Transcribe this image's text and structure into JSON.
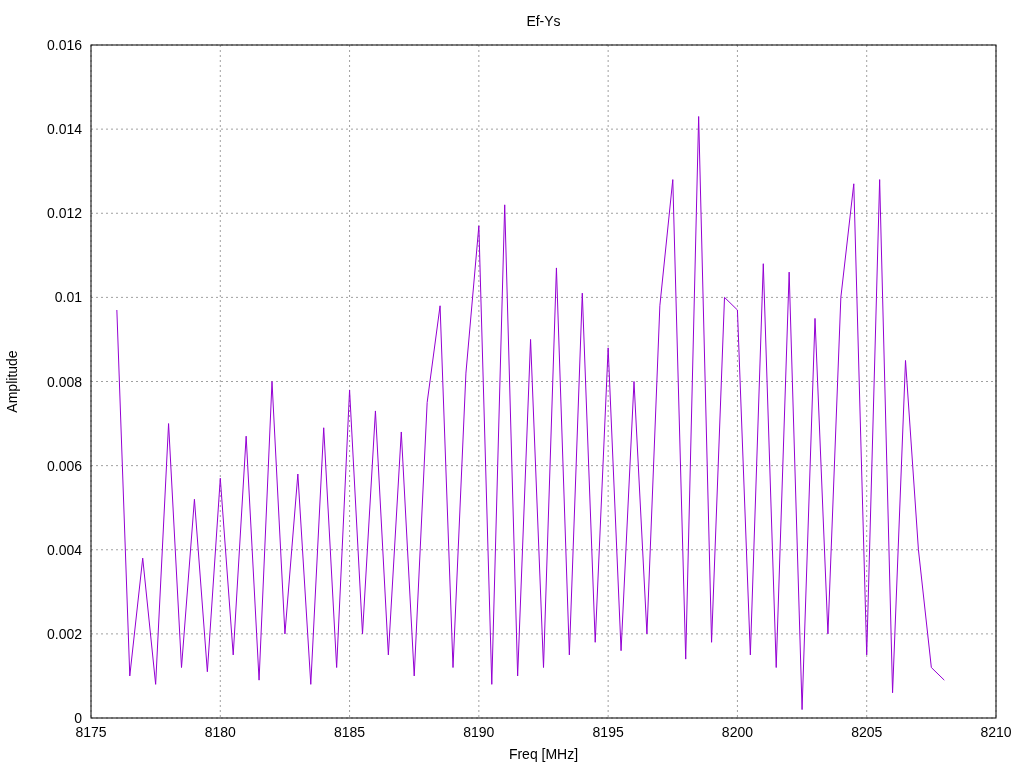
{
  "chart_data": {
    "type": "line",
    "title": "Ef-Ys",
    "xlabel": "Freq [MHz]",
    "ylabel": "Amplitude",
    "x": [
      8176,
      8176.5,
      8177,
      8177.5,
      8178,
      8178.5,
      8179,
      8179.5,
      8180,
      8180.5,
      8181,
      8181.5,
      8182,
      8182.5,
      8183,
      8183.5,
      8184,
      8184.5,
      8185,
      8185.5,
      8186,
      8186.5,
      8187,
      8187.5,
      8188,
      8188.5,
      8189,
      8189.5,
      8190,
      8190.5,
      8191,
      8191.5,
      8192,
      8192.5,
      8193,
      8193.5,
      8194,
      8194.5,
      8195,
      8195.5,
      8196,
      8196.5,
      8197,
      8197.5,
      8198,
      8198.5,
      8199,
      8199.5,
      8200,
      8200.5,
      8201,
      8201.5,
      8202,
      8202.5,
      8203,
      8203.5,
      8204,
      8204.5,
      8205,
      8205.5,
      8206,
      8206.5,
      8207,
      8207.5,
      8208
    ],
    "grid": true,
    "series": [
      {
        "color": "#9400d3",
        "values": [
          0.0097,
          0.001,
          0.0038,
          0.0008,
          0.007,
          0.0012,
          0.0052,
          0.0011,
          0.0057,
          0.0015,
          0.0067,
          0.0009,
          0.008,
          0.002,
          0.0058,
          0.0008,
          0.0069,
          0.0012,
          0.0078,
          0.002,
          0.0073,
          0.0015,
          0.0068,
          0.001,
          0.0075,
          0.0098,
          0.0012,
          0.0082,
          0.0117,
          0.0008,
          0.0122,
          0.001,
          0.009,
          0.0012,
          0.0107,
          0.0015,
          0.0101,
          0.0018,
          0.0088,
          0.0016,
          0.008,
          0.002,
          0.0098,
          0.0128,
          0.0014,
          0.0143,
          0.0018,
          0.01,
          0.0097,
          0.0015,
          0.0108,
          0.0012,
          0.0106,
          0.0002,
          0.0095,
          0.002,
          0.01,
          0.0127,
          0.0015,
          0.0128,
          0.0006,
          0.0085,
          0.004,
          0.0012,
          0.0009
        ]
      }
    ],
    "xlim": [
      8175,
      8210
    ],
    "ylim": [
      0,
      0.016
    ],
    "xticks": [
      8175,
      8180,
      8185,
      8190,
      8195,
      8200,
      8205,
      8210
    ],
    "yticks": [
      0,
      0.002,
      0.004,
      0.006,
      0.008,
      0.01,
      0.012,
      0.014,
      0.016
    ]
  }
}
